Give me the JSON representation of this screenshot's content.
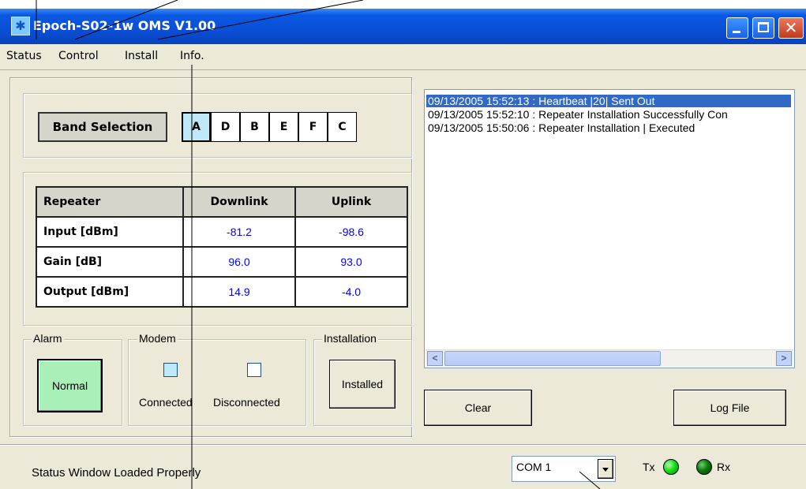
{
  "window": {
    "title": "Epoch-S02-1w OMS V1.00"
  },
  "menu": [
    "Status",
    "Control",
    "Install",
    "Info."
  ],
  "band_selection": {
    "label": "Band Selection",
    "bands": [
      "A",
      "D",
      "B",
      "E",
      "F",
      "C"
    ],
    "active": "A"
  },
  "repeater_table": {
    "headers": [
      "Repeater",
      "Downlink",
      "Uplink"
    ],
    "rows": [
      {
        "label": "Input [dBm]",
        "downlink": "-81.2",
        "uplink": "-98.6"
      },
      {
        "label": "Gain [dB]",
        "downlink": "96.0",
        "uplink": "93.0"
      },
      {
        "label": "Output [dBm]",
        "downlink": "14.9",
        "uplink": "-4.0"
      }
    ]
  },
  "alarm": {
    "legend": "Alarm",
    "button": "Normal"
  },
  "modem": {
    "legend": "Modem",
    "connected": "Connected",
    "disconnected": "Disconnected"
  },
  "installation": {
    "legend": "Installation",
    "button": "Installed"
  },
  "log": {
    "lines": [
      "09/13/2005 15:52:13 : Heartbeat |20| Sent Out",
      "09/13/2005 15:52:10 : Repeater Installation Successfully Con",
      "09/13/2005 15:50:06 : Repeater Installation | Executed"
    ],
    "selected_index": 0
  },
  "buttons": {
    "clear": "Clear",
    "log_file": "Log File"
  },
  "status_bar": {
    "message": "Status Window Loaded Properly",
    "com_port": "COM 1",
    "tx": "Tx",
    "rx": "Rx"
  },
  "colors": {
    "titlebar": "#0a58e2",
    "selection": "#316ac5",
    "value_text": "#0000ff",
    "tx_led": "#18e018",
    "rx_led": "#0b7a0b",
    "alarm_normal": "#a8f0b8",
    "modem_connected": "#bfe8f8"
  },
  "icons": {
    "app_icon": "snowflake-icon",
    "minimize": "minimize-icon",
    "maximize": "maximize-icon",
    "close": "close-icon"
  }
}
